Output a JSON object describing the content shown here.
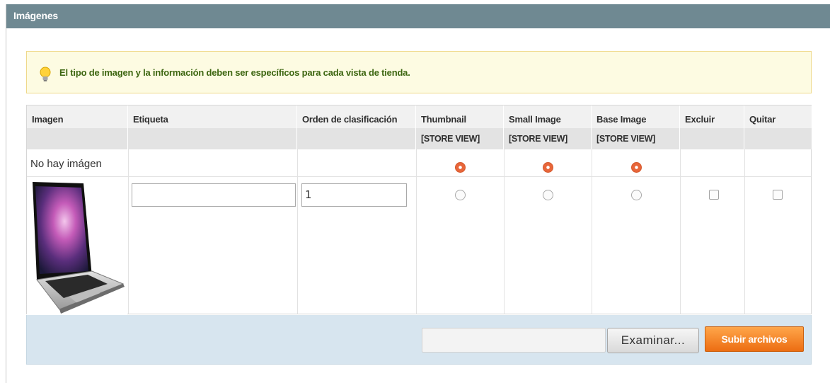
{
  "panel": {
    "title": "Imágenes"
  },
  "notice": {
    "icon": "lightbulb-icon",
    "text": "El tipo de imagen y la información deben ser específicos para cada vista de tienda."
  },
  "columns": {
    "image": "Imagen",
    "label": "Etiqueta",
    "sort_order": "Orden de clasificación",
    "thumbnail": "Thumbnail",
    "thumbnail_scope": "[STORE VIEW]",
    "small_image": "Small Image",
    "small_image_scope": "[STORE VIEW]",
    "base_image": "Base Image",
    "base_image_scope": "[STORE VIEW]",
    "exclude": "Excluir",
    "remove": "Quitar"
  },
  "rows": {
    "no_image": {
      "text": "No hay imágen",
      "thumbnail_selected": true,
      "small_image_selected": true,
      "base_image_selected": true
    },
    "image_1": {
      "label_value": "",
      "sort_order_value": "1",
      "thumbnail_selected": false,
      "small_image_selected": false,
      "base_image_selected": false,
      "exclude_checked": false,
      "remove_checked": false
    }
  },
  "footer": {
    "file_value": "",
    "browse_label": "Examinar...",
    "upload_label": "Subir archivos"
  },
  "colors": {
    "header": "#6f8992",
    "accent": "#ec6d12",
    "radio_on": "#e8663a",
    "notice_text": "#3d6611"
  }
}
